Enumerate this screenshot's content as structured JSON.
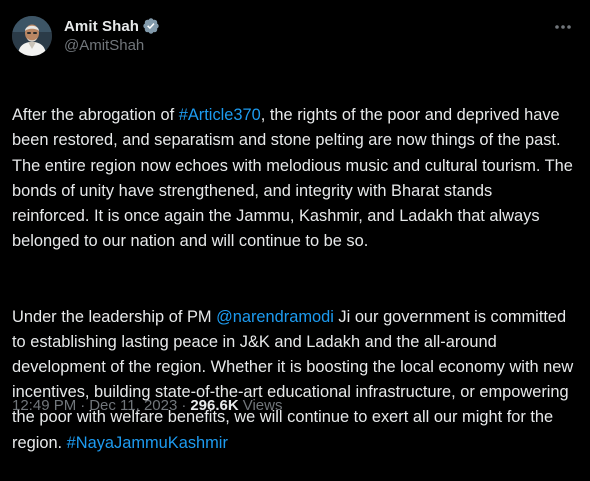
{
  "author": {
    "display_name": "Amit Shah",
    "handle": "@AmitShah",
    "verified": true,
    "verified_color": "#829aab"
  },
  "tweet": {
    "paragraph1": {
      "pre": "After the abrogation of ",
      "hashtag": "#Article370",
      "post": ", the rights of the poor and deprived have been restored, and separatism and stone pelting are now things of the past. The entire region now echoes with melodious music and cultural tourism. The bonds of unity have strengthened, and integrity with Bharat stands reinforced. It is once again the Jammu, Kashmir, and Ladakh that always belonged to our nation and will continue to be so."
    },
    "paragraph2": {
      "pre": "Under the leadership of PM ",
      "mention": "@narendramodi",
      "mid": " Ji our government is committed to establishing lasting peace in J&K and Ladakh and the all-around development of the region. Whether it is boosting the local economy with new incentives, building state-of-the-art educational infrastructure, or empowering the poor with welfare benefits, we will continue to exert all our might for the region. ",
      "hashtag": "#NayaJammuKashmir"
    }
  },
  "meta": {
    "time": "12:49 PM",
    "separator": "·",
    "date": "Dec 11, 2023",
    "views_count": "296.6K",
    "views_label": "Views"
  },
  "colors": {
    "background": "#000000",
    "text": "#e7e9ea",
    "secondary": "#71767b",
    "link": "#1d9bf0"
  },
  "icons": {
    "verified": "verified-badge-icon",
    "more": "more-options-icon"
  }
}
